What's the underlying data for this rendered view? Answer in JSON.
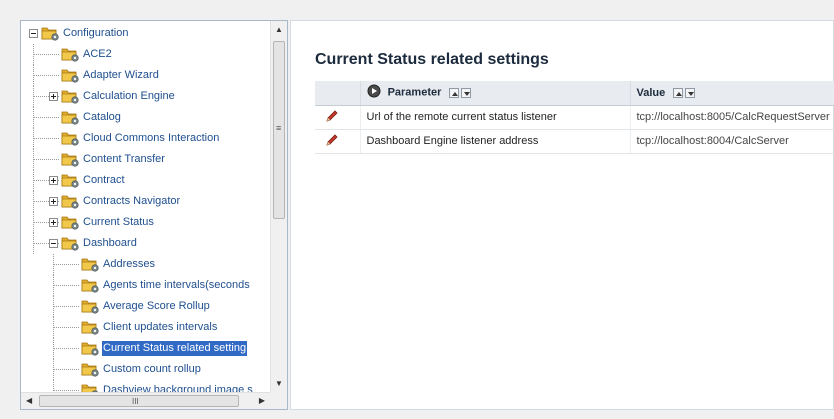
{
  "tree": {
    "nodes": [
      {
        "label": "Configuration",
        "level": 0,
        "expander": "minus",
        "selected": false
      },
      {
        "label": "ACE2",
        "level": 1,
        "expander": "none",
        "selected": false
      },
      {
        "label": "Adapter Wizard",
        "level": 1,
        "expander": "none",
        "selected": false
      },
      {
        "label": "Calculation Engine",
        "level": 1,
        "expander": "plus",
        "selected": false
      },
      {
        "label": "Catalog",
        "level": 1,
        "expander": "none",
        "selected": false
      },
      {
        "label": "Cloud Commons Interaction",
        "level": 1,
        "expander": "none",
        "selected": false
      },
      {
        "label": "Content Transfer",
        "level": 1,
        "expander": "none",
        "selected": false
      },
      {
        "label": "Contract",
        "level": 1,
        "expander": "plus",
        "selected": false
      },
      {
        "label": "Contracts Navigator",
        "level": 1,
        "expander": "plus",
        "selected": false
      },
      {
        "label": "Current Status",
        "level": 1,
        "expander": "plus",
        "selected": false
      },
      {
        "label": "Dashboard",
        "level": 1,
        "expander": "minus",
        "selected": false
      },
      {
        "label": "Addresses",
        "level": 2,
        "expander": "none",
        "selected": false
      },
      {
        "label": "Agents time intervals(seconds",
        "level": 2,
        "expander": "none",
        "selected": false
      },
      {
        "label": "Average Score Rollup",
        "level": 2,
        "expander": "none",
        "selected": false
      },
      {
        "label": "Client updates intervals",
        "level": 2,
        "expander": "none",
        "selected": false
      },
      {
        "label": "Current Status related setting",
        "level": 2,
        "expander": "none",
        "selected": true
      },
      {
        "label": "Custom count rollup",
        "level": 2,
        "expander": "none",
        "selected": false
      },
      {
        "label": "Dashview background image s",
        "level": 2,
        "expander": "none",
        "selected": false
      }
    ],
    "hscroll_thumb_glyph": "III"
  },
  "main": {
    "title": "Current Status related settings",
    "columns": {
      "parameter": "Parameter",
      "value": "Value"
    },
    "rows": [
      {
        "parameter": "Url of the remote current status listener",
        "value": "tcp://localhost:8005/CalcRequestServer"
      },
      {
        "parameter": "Dashboard Engine listener address",
        "value": "tcp://localhost:8004/CalcServer"
      }
    ]
  },
  "icons": {
    "tree_folder": "folder-gear-icon",
    "edit": "pencil-icon",
    "parameter_header": "arrow-circle-icon",
    "sort_asc": "sort-ascending-icon",
    "sort_desc": "sort-descending-icon"
  },
  "colors": {
    "tree_text": "#1f4f8f",
    "selection": "#316ac5",
    "folder": "#f2c84b",
    "pencil": "#c0392b",
    "header_bg": "#e8ebef"
  }
}
